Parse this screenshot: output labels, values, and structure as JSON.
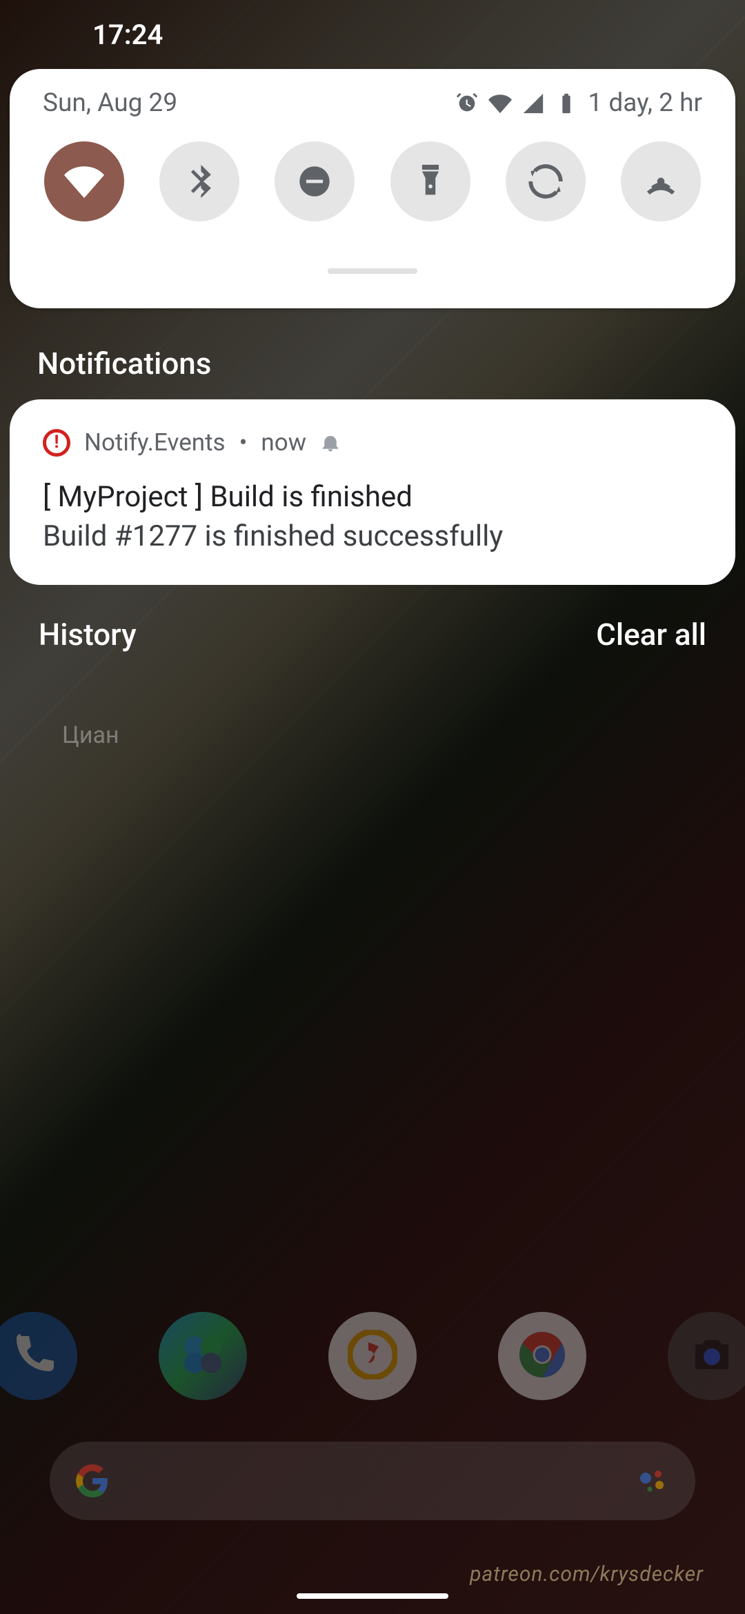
{
  "statusbar": {
    "time": "17:24"
  },
  "qs": {
    "date": "Sun, Aug 29",
    "battery_text": "1 day, 2 hr",
    "tiles": {
      "wifi": {
        "name": "wifi-icon",
        "active": true
      },
      "bluetooth": {
        "name": "bluetooth-icon",
        "active": false
      },
      "dnd": {
        "name": "dnd-icon",
        "active": false
      },
      "torch": {
        "name": "flashlight-icon",
        "active": false
      },
      "rotate": {
        "name": "autorotate-icon",
        "active": false
      },
      "hotspot": {
        "name": "hotspot-icon",
        "active": false
      }
    }
  },
  "sections": {
    "notifications_label": "Notifications",
    "history_label": "History",
    "clear_all_label": "Clear all"
  },
  "notification": {
    "app_name": "Notify.Events",
    "time": "now",
    "title": "[ MyProject ] Build is finished",
    "body": "Build #1277 is finished successfully"
  },
  "background": {
    "app_label_1": "Циан",
    "watermark_line1": "patreon.com/krysdecker"
  },
  "dock": {
    "items": [
      "phone",
      "social-folder",
      "music",
      "chrome",
      "camera"
    ]
  },
  "colors": {
    "tile_active": "#8c5a4e",
    "tile_inactive": "#e5e5e5",
    "alert_red": "#d42020"
  }
}
